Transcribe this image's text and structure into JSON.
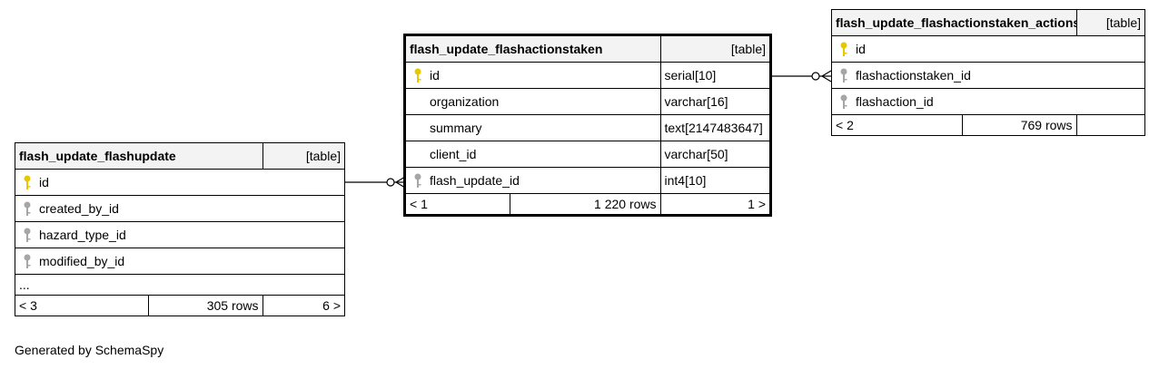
{
  "tables": {
    "flashupdate": {
      "name": "flash_update_flashupdate",
      "kind": "[table]",
      "columns": [
        {
          "name": "id",
          "key": "primary"
        },
        {
          "name": "created_by_id",
          "key": "foreign"
        },
        {
          "name": "hazard_type_id",
          "key": "foreign"
        },
        {
          "name": "modified_by_id",
          "key": "foreign"
        }
      ],
      "more": "...",
      "footer": {
        "left": "< 3",
        "rows": "305 rows",
        "right": "6 >"
      }
    },
    "flashactionstaken": {
      "name": "flash_update_flashactionstaken",
      "kind": "[table]",
      "columns": [
        {
          "name": "id",
          "type": "serial[10]",
          "key": "primary"
        },
        {
          "name": "organization",
          "type": "varchar[16]",
          "key": "none"
        },
        {
          "name": "summary",
          "type": "text[2147483647]",
          "key": "none"
        },
        {
          "name": "client_id",
          "type": "varchar[50]",
          "key": "none"
        },
        {
          "name": "flash_update_id",
          "type": "int4[10]",
          "key": "foreign"
        }
      ],
      "footer": {
        "left": "< 1",
        "rows": "1 220 rows",
        "right": "1 >"
      }
    },
    "actions": {
      "name": "flash_update_flashactionstaken_actions",
      "kind": "[table]",
      "columns": [
        {
          "name": "id",
          "key": "primary"
        },
        {
          "name": "flashactionstaken_id",
          "key": "foreign"
        },
        {
          "name": "flashaction_id",
          "key": "foreign"
        }
      ],
      "footer": {
        "left": "< 2",
        "rows": "769 rows",
        "right": ""
      }
    }
  },
  "key_colors": {
    "primary": "#e6c800",
    "foreign": "#a6a6a6"
  },
  "generated_by": "Generated by SchemaSpy"
}
